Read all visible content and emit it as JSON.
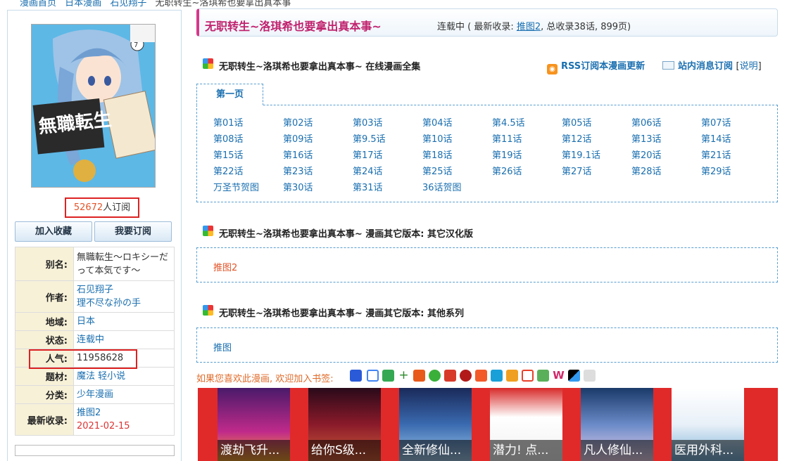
{
  "breadcrumb": {
    "items": [
      "漫画首页",
      "日本漫画",
      "石见翔子",
      "无职转生~洛琪希也要拿出真本事"
    ]
  },
  "sidebar": {
    "subscribers_count": "52672",
    "subscribers_suffix": "人订阅",
    "favorite_button": "加入收藏",
    "subscribe_button": "我要订阅",
    "info": {
      "alias_label": "别名:",
      "alias_value": "無職転生～ロキシーだって本気です～",
      "author_label": "作者:",
      "author_value_1": "石见翔子",
      "author_value_2": "理不尽な孙の手",
      "region_label": "地域:",
      "region_value": "日本",
      "status_label": "状态:",
      "status_value": "连载中",
      "popularity_label": "人气:",
      "popularity_value": "11958628",
      "genre_label": "题材:",
      "genre_value": "魔法 轻小说",
      "category_label": "分类:",
      "category_value": "少年漫画",
      "latest_label": "最新收录:",
      "latest_value": "推图2",
      "latest_date": "2021-02-15"
    }
  },
  "header": {
    "title": "无职转生~洛琪希也要拿出真本事~",
    "status_prefix": "连载中 ( 最新收录: ",
    "status_latest": "推图2",
    "status_suffix": ", 总收录38话, 899页)"
  },
  "section_full": {
    "title": "无职转生~洛琪希也要拿出真本事~ 在线漫画全集",
    "rss_label": "RSS订阅本漫画更新",
    "rss_icon": "rss-icon",
    "mail_label": "站内消息订阅",
    "mail_icon": "mail-icon",
    "explain_label": "说明",
    "tab_label": "第一页",
    "chapters": [
      [
        "第01话",
        "第02话",
        "第03话",
        "第04话",
        "第4.5话",
        "第05话",
        "第06话",
        "第07话"
      ],
      [
        "第08话",
        "第09话",
        "第9.5话",
        "第10话",
        "第11话",
        "第12话",
        "第13话",
        "第14话"
      ],
      [
        "第15话",
        "第16话",
        "第17话",
        "第18话",
        "第19话",
        "第19.1话",
        "第20话",
        "第21话"
      ],
      [
        "第22话",
        "第23话",
        "第24话",
        "第25话",
        "第26话",
        "第27话",
        "第28话",
        "第29话"
      ],
      [
        "万圣节贺图",
        "第30话",
        "第31话",
        "36话贺图"
      ]
    ]
  },
  "section_other_translation": {
    "title": "无职转生~洛琪希也要拿出真本事~ 漫画其它版本: 其它汉化版",
    "item": "推图2"
  },
  "section_other_series": {
    "title": "无职转生~洛琪希也要拿出真本事~ 漫画其它版本: 其他系列",
    "item": "推图"
  },
  "bookmark": {
    "text": "如果您喜欢此漫画, 欢迎加入书签:"
  },
  "ads": [
    "渡劫飞升...",
    "给你S级...",
    "全新修仙...",
    "潜力! 点...",
    "凡人修仙...",
    "医用外科..."
  ],
  "colors": {
    "accent_pink": "#c0226e",
    "link_blue": "#1a6fb0",
    "highlight_red": "#d22",
    "ad_red": "#e02a2a"
  }
}
